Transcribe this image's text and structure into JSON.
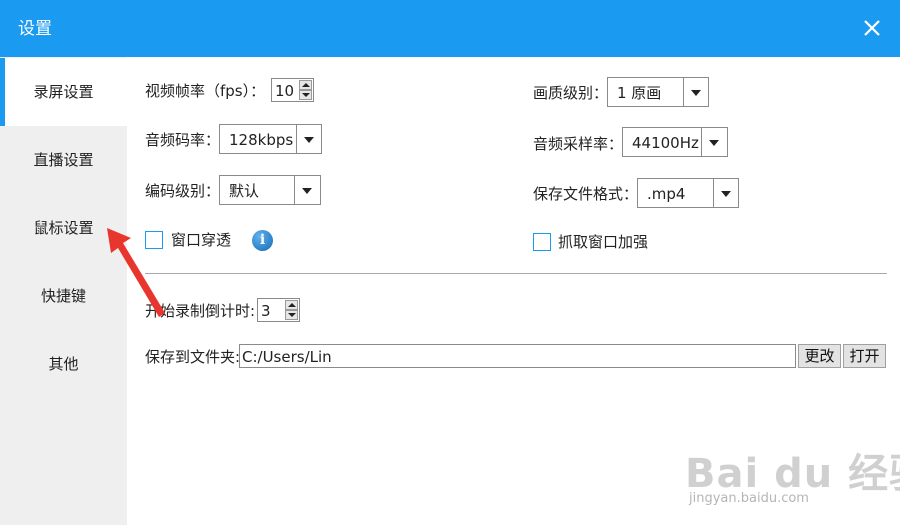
{
  "window": {
    "title": "设置"
  },
  "sidebar": {
    "items": [
      {
        "label": "录屏设置",
        "active": true
      },
      {
        "label": "直播设置",
        "active": false
      },
      {
        "label": "鼠标设置",
        "active": false
      },
      {
        "label": "快捷键",
        "active": false
      },
      {
        "label": "其他",
        "active": false
      }
    ]
  },
  "record": {
    "fps_label": "视频帧率（fps）：",
    "fps_value": "10",
    "quality_label": "画质级别：",
    "quality_value": "1 原画",
    "audio_bitrate_label": "音频码率：",
    "audio_bitrate_value": "128kbps",
    "sample_rate_label": "音频采样率：",
    "sample_rate_value": "44100Hz",
    "encode_level_label": "编码级别：",
    "encode_level_value": "默认",
    "file_format_label": "保存文件格式：",
    "file_format_value": ".mp4",
    "window_through_label": "窗口穿透",
    "window_through_checked": false,
    "capture_enhance_label": "抓取窗口加强",
    "capture_enhance_checked": false,
    "info_glyph": "i",
    "countdown_label": "开始录制倒计时:",
    "countdown_value": "3",
    "save_folder_label": "保存到文件夹:",
    "save_folder_value": "C:/Users/Lin",
    "change_button": "更改",
    "open_button": "打开"
  },
  "watermark": {
    "brand": "Bai du 经验",
    "site": "jingyan.baidu.com"
  },
  "colors": {
    "accent": "#1a9af0",
    "sidebar_bg": "#efefef",
    "annotation": "#e8352e"
  }
}
